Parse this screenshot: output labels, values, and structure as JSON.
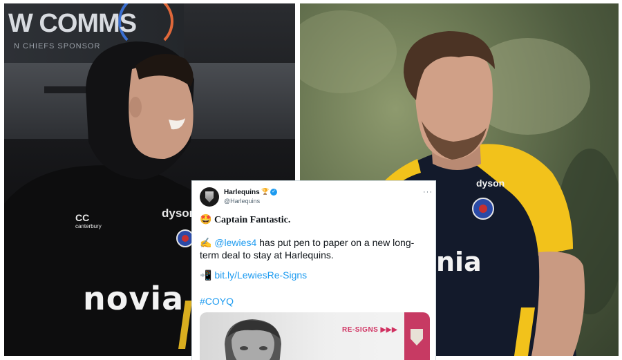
{
  "left_photo": {
    "banner_text": "W COMMS",
    "banner_subtext": "N CHIEFS SPONSOR",
    "shirt_brand": "canterbury",
    "shirt_sponsor_chest": "dyson",
    "shirt_sponsor_front": "novia"
  },
  "right_photo": {
    "shirt_sponsor_chest": "dyson",
    "shirt_sponsor_front": "nia"
  },
  "tweet": {
    "display_name": "Harlequins",
    "name_emoji": "🏆",
    "handle": "@Harlequins",
    "more": "···",
    "headline_emoji": "🤩",
    "headline": "Captain Fantastic.",
    "body_emoji": "✍️",
    "mention": "@lewies4",
    "body_text": " has put pen to paper on a new long-term deal to stay at Harlequins.",
    "link_emoji": "📲",
    "link": "bit.ly/LewiesRe-Signs",
    "hashtag": "#COYQ",
    "media_tag": "RE-SIGNS ▶▶▶"
  },
  "colors": {
    "twitter_blue": "#1d9bf0",
    "harlequins_pink": "#c73a63",
    "bath_yellow": "#f2c21b",
    "bath_navy": "#131a2b"
  }
}
